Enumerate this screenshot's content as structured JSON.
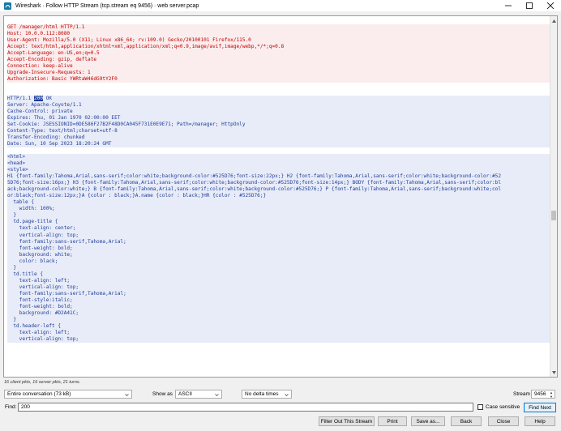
{
  "window": {
    "title": "Wireshark · Follow HTTP Stream (tcp.stream eq 9456) · web server.pcap",
    "controls": [
      "minimize-icon",
      "maximize-icon",
      "close-icon"
    ]
  },
  "stream": {
    "lines": [
      {
        "side": "client",
        "text": "GET /manager/html HTTP/1.1"
      },
      {
        "side": "client",
        "text": "Host: 10.0.0.112:8080"
      },
      {
        "side": "client",
        "text": "User-Agent: Mozilla/5.0 (X11; Linux x86_64; rv:109.0) Gecko/20100101 Firefox/115.0"
      },
      {
        "side": "client",
        "text": "Accept: text/html,application/xhtml+xml,application/xml;q=0.9,image/avif,image/webp,*/*;q=0.8"
      },
      {
        "side": "client",
        "text": "Accept-Language: en-US,en;q=0.5"
      },
      {
        "side": "client",
        "text": "Accept-Encoding: gzip, deflate"
      },
      {
        "side": "client",
        "text": "Connection: keep-alive"
      },
      {
        "side": "client",
        "text": "Upgrade-Insecure-Requests: 1"
      },
      {
        "side": "client",
        "text": "Authorization: Basic YWRtaW46dG9tY2F0"
      },
      {
        "side": "blank",
        "text": ""
      },
      {
        "side": "blank",
        "text": ""
      },
      {
        "side": "server",
        "text": "HTTP/1.1 ",
        "match": "200",
        "after": " OK"
      },
      {
        "side": "server",
        "text": "Server: Apache-Coyote/1.1"
      },
      {
        "side": "server",
        "text": "Cache-Control: private"
      },
      {
        "side": "server",
        "text": "Expires: Thu, 01 Jan 1970 02:00:00 EET"
      },
      {
        "side": "server",
        "text": "Set-Cookie: JSESSIONID=0DE586F27B2F48D0CA045F731E0E9E71; Path=/manager; HttpOnly"
      },
      {
        "side": "server",
        "text": "Content-Type: text/html;charset=utf-8"
      },
      {
        "side": "server",
        "text": "Transfer-Encoding: chunked"
      },
      {
        "side": "server",
        "text": "Date: Sun, 10 Sep 2023 18:20:24 GMT"
      },
      {
        "side": "blank",
        "text": ""
      },
      {
        "side": "server",
        "text": "<html>"
      },
      {
        "side": "server",
        "text": "<head>"
      },
      {
        "side": "server",
        "text": "<style>"
      },
      {
        "side": "server",
        "text": "H1 {font-family:Tahoma,Arial,sans-serif;color:white;background-color:#525D76;font-size:22px;} H2 {font-family:Tahoma,Arial,sans-serif;color:white;background-color:#52"
      },
      {
        "side": "server",
        "text": "5D76;font-size:16px;} H3 {font-family:Tahoma,Arial,sans-serif;color:white;background-color:#525D76;font-size:14px;} BODY {font-family:Tahoma,Arial,sans-serif;color:bl"
      },
      {
        "side": "server",
        "text": "ack;background-color:white;} B {font-family:Tahoma,Arial,sans-serif;color:white;background-color:#525D76;} P {font-family:Tahoma,Arial,sans-serif;background:white;col"
      },
      {
        "side": "server",
        "text": "or:black;font-size:12px;}A {color : black;}A.name {color : black;}HR {color : #525D76;}"
      },
      {
        "side": "server",
        "text": "  table {"
      },
      {
        "side": "server",
        "text": "    width: 100%;"
      },
      {
        "side": "server",
        "text": "  }"
      },
      {
        "side": "server",
        "text": "  td.page-title {"
      },
      {
        "side": "server",
        "text": "    text-align: center;"
      },
      {
        "side": "server",
        "text": "    vertical-align: top;"
      },
      {
        "side": "server",
        "text": "    font-family:sans-serif,Tahoma,Arial;"
      },
      {
        "side": "server",
        "text": "    font-weight: bold;"
      },
      {
        "side": "server",
        "text": "    background: white;"
      },
      {
        "side": "server",
        "text": "    color: black;"
      },
      {
        "side": "server",
        "text": "  }"
      },
      {
        "side": "server",
        "text": "  td.title {"
      },
      {
        "side": "server",
        "text": "    text-align: left;"
      },
      {
        "side": "server",
        "text": "    vertical-align: top;"
      },
      {
        "side": "server",
        "text": "    font-family:sans-serif,Tahoma,Arial;"
      },
      {
        "side": "server",
        "text": "    font-style:italic;"
      },
      {
        "side": "server",
        "text": "    font-weight: bold;"
      },
      {
        "side": "server",
        "text": "    background: #D2A41C;"
      },
      {
        "side": "server",
        "text": "  }"
      },
      {
        "side": "server",
        "text": "  td.header-left {"
      },
      {
        "side": "server",
        "text": "    text-align: left;"
      },
      {
        "side": "server",
        "text": "    vertical-align: top;"
      }
    ]
  },
  "summary": "16 client pkts, 16 server pkts, 21 turns.",
  "controls": {
    "conversation_select": "Entire conversation (73 kB)",
    "show_as_label": "Show as",
    "show_as_select": "ASCII",
    "delta_select": "No delta times",
    "stream_label": "Stream",
    "stream_value": "9456",
    "find_label": "Find:",
    "find_value": "200",
    "case_sensitive_label": "Case sensitive",
    "find_next_label": "Find Next",
    "filter_out_label": "Filter Out This Stream",
    "print_label": "Print",
    "save_as_label": "Save as...",
    "back_label": "Back",
    "close_label": "Close",
    "help_label": "Help"
  },
  "colors": {
    "client_text": "#c00000",
    "client_bg": "#fbeded",
    "server_text": "#1f3d9a",
    "server_bg": "#e8ecf8"
  }
}
